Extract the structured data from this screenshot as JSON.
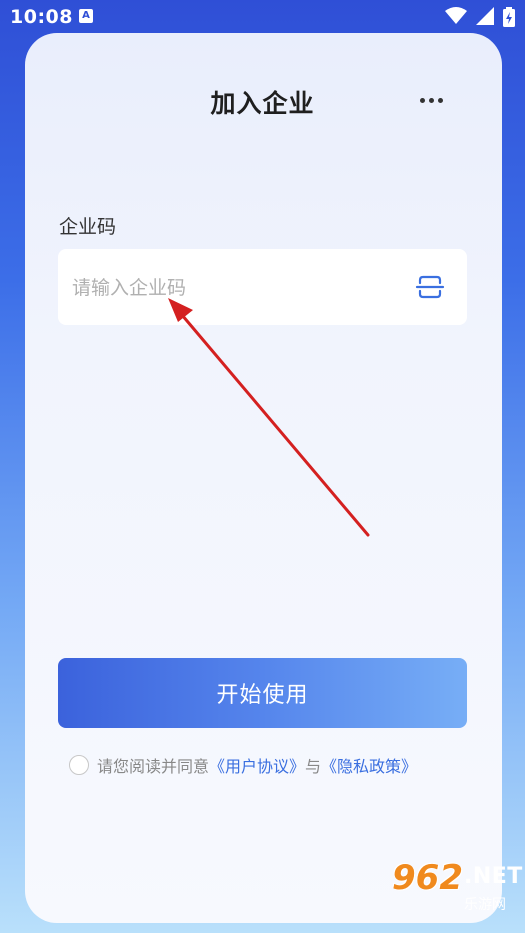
{
  "status_bar": {
    "time": "10:08",
    "app_icon_letter": "A",
    "icons": [
      "wifi-icon",
      "signal-icon",
      "battery-charging-icon"
    ]
  },
  "header": {
    "title": "加入企业",
    "more_icon": "more-horizontal-icon"
  },
  "form": {
    "label": "企业码",
    "input_value": "",
    "input_placeholder": "请输入企业码",
    "scan_icon": "scan-icon"
  },
  "actions": {
    "start_label": "开始使用"
  },
  "agreement": {
    "checked": false,
    "prefix": "请您阅读并同意",
    "user_agreement": "《用户协议》",
    "conjunction": "与",
    "privacy_policy": "《隐私政策》"
  },
  "watermark": {
    "number": "962",
    "net": ".NET",
    "sub": "乐游网"
  },
  "colors": {
    "accent": "#3a6fe0",
    "arrow": "#d42020",
    "button_start": "#3b62dc",
    "button_end": "#77aef6"
  }
}
